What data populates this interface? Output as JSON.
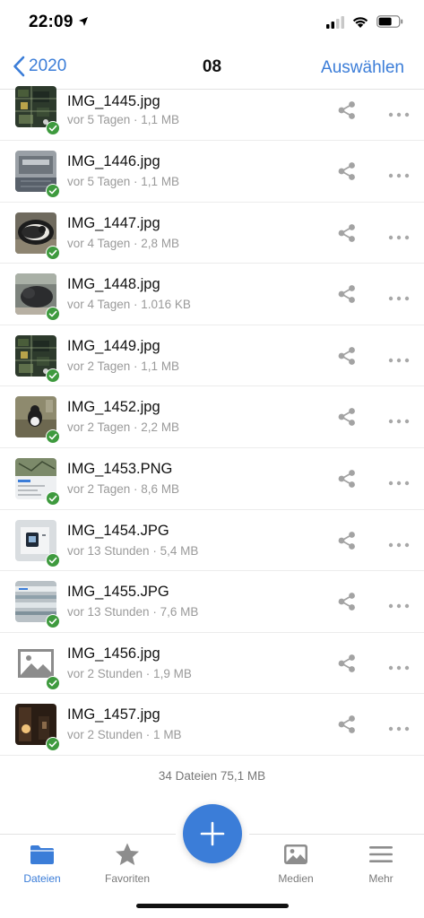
{
  "status_bar": {
    "time": "22:09",
    "icons": [
      "location-arrow-icon",
      "cellular-signal-icon",
      "wifi-icon",
      "battery-icon"
    ]
  },
  "nav": {
    "back_label": "2020",
    "title": "08",
    "action_label": "Auswählen"
  },
  "files": [
    {
      "name": "IMG_1445.jpg",
      "meta": "vor 5 Tagen · 1,1 MB",
      "thumb": "circuit-board"
    },
    {
      "name": "IMG_1446.jpg",
      "meta": "vor 5 Tagen · 1,1 MB",
      "thumb": "metal-device"
    },
    {
      "name": "IMG_1447.jpg",
      "meta": "vor 4 Tagen · 2,8 MB",
      "thumb": "cat-dark"
    },
    {
      "name": "IMG_1448.jpg",
      "meta": "vor 4 Tagen · 1.016 KB",
      "thumb": "cat-grey"
    },
    {
      "name": "IMG_1449.jpg",
      "meta": "vor 2 Tagen · 1,1 MB",
      "thumb": "circuit-board"
    },
    {
      "name": "IMG_1452.jpg",
      "meta": "vor 2 Tagen · 2,2 MB",
      "thumb": "cat-outdoor"
    },
    {
      "name": "IMG_1453.PNG",
      "meta": "vor 2 Tagen · 8,6 MB",
      "thumb": "screenshot"
    },
    {
      "name": "IMG_1454.JPG",
      "meta": "vor 13 Stunden · 5,4 MB",
      "thumb": "device-screen"
    },
    {
      "name": "IMG_1455.JPG",
      "meta": "vor 13 Stunden · 7,6 MB",
      "thumb": "blurry-screen"
    },
    {
      "name": "IMG_1456.jpg",
      "meta": "vor 2 Stunden · 1,9 MB",
      "thumb": "placeholder-image"
    },
    {
      "name": "IMG_1457.jpg",
      "meta": "vor 2 Stunden · 1 MB",
      "thumb": "dark-room"
    }
  ],
  "summary": "34 Dateien 75,1 MB",
  "tabs": [
    {
      "label": "Dateien",
      "icon": "folder-icon",
      "active": true
    },
    {
      "label": "Favoriten",
      "icon": "star-icon",
      "active": false
    },
    {
      "label": "Medien",
      "icon": "image-icon",
      "active": false
    },
    {
      "label": "Mehr",
      "icon": "menu-icon",
      "active": false
    }
  ],
  "colors": {
    "accent": "#3b7dd8",
    "check": "#3e9a3e",
    "meta_text": "#9a9a9a",
    "icon_grey": "#9b9b9b"
  }
}
